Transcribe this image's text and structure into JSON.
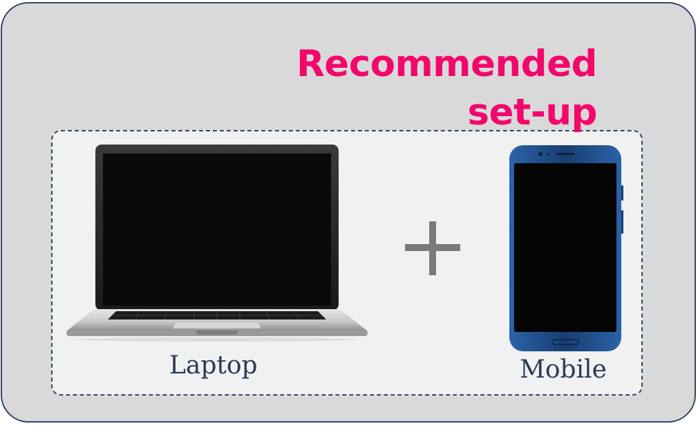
{
  "title": {
    "line1": "Recommended",
    "line2": "set-up"
  },
  "devices": [
    {
      "label": "Laptop",
      "icon": "laptop-icon"
    },
    {
      "label": "Mobile",
      "icon": "mobile-phone-icon"
    }
  ],
  "separator_icon": "plus-icon",
  "colors": {
    "title": "#f2086c",
    "border": "#2f4468",
    "background": "#d9d9d9",
    "inner_background": "#f1f1f1",
    "phone_body": "#1e4a86",
    "screen": "#050505",
    "plus": "#7a7a7a"
  }
}
